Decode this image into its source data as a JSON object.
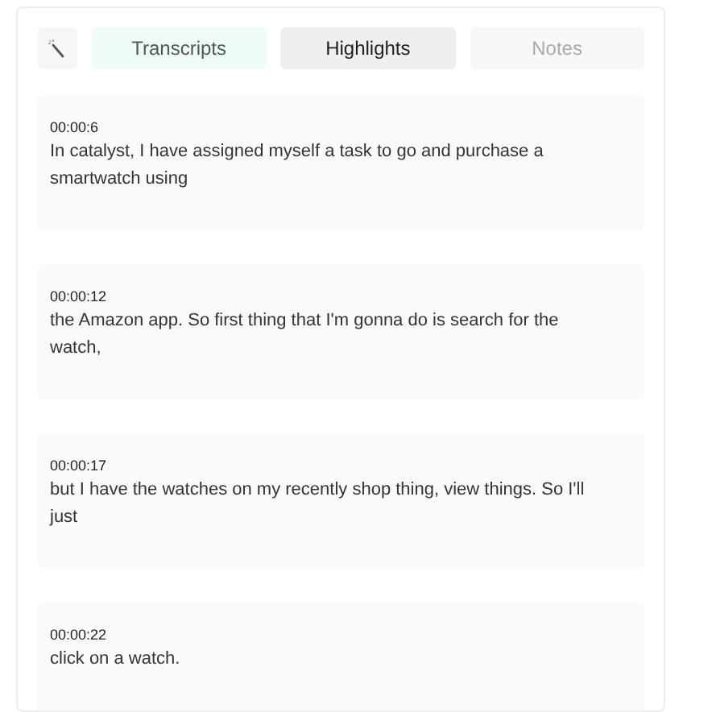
{
  "tabs": [
    {
      "label": "Transcripts",
      "selected": false,
      "hovered": true,
      "disabled": false
    },
    {
      "label": "Highlights",
      "selected": true,
      "hovered": false,
      "disabled": false
    },
    {
      "label": "Notes",
      "selected": false,
      "hovered": false,
      "disabled": true
    }
  ],
  "highlights": [
    {
      "time": "00:00:6",
      "text": "In catalyst, I have assigned myself a task to go and purchase a smartwatch using"
    },
    {
      "time": "00:00:12",
      "text": "the Amazon app. So first thing that I'm gonna do is search for the watch,"
    },
    {
      "time": "00:00:17",
      "text": "but I have the watches on my recently shop thing, view things. So I'll just"
    },
    {
      "time": "00:00:22",
      "text": "click on a watch."
    }
  ]
}
